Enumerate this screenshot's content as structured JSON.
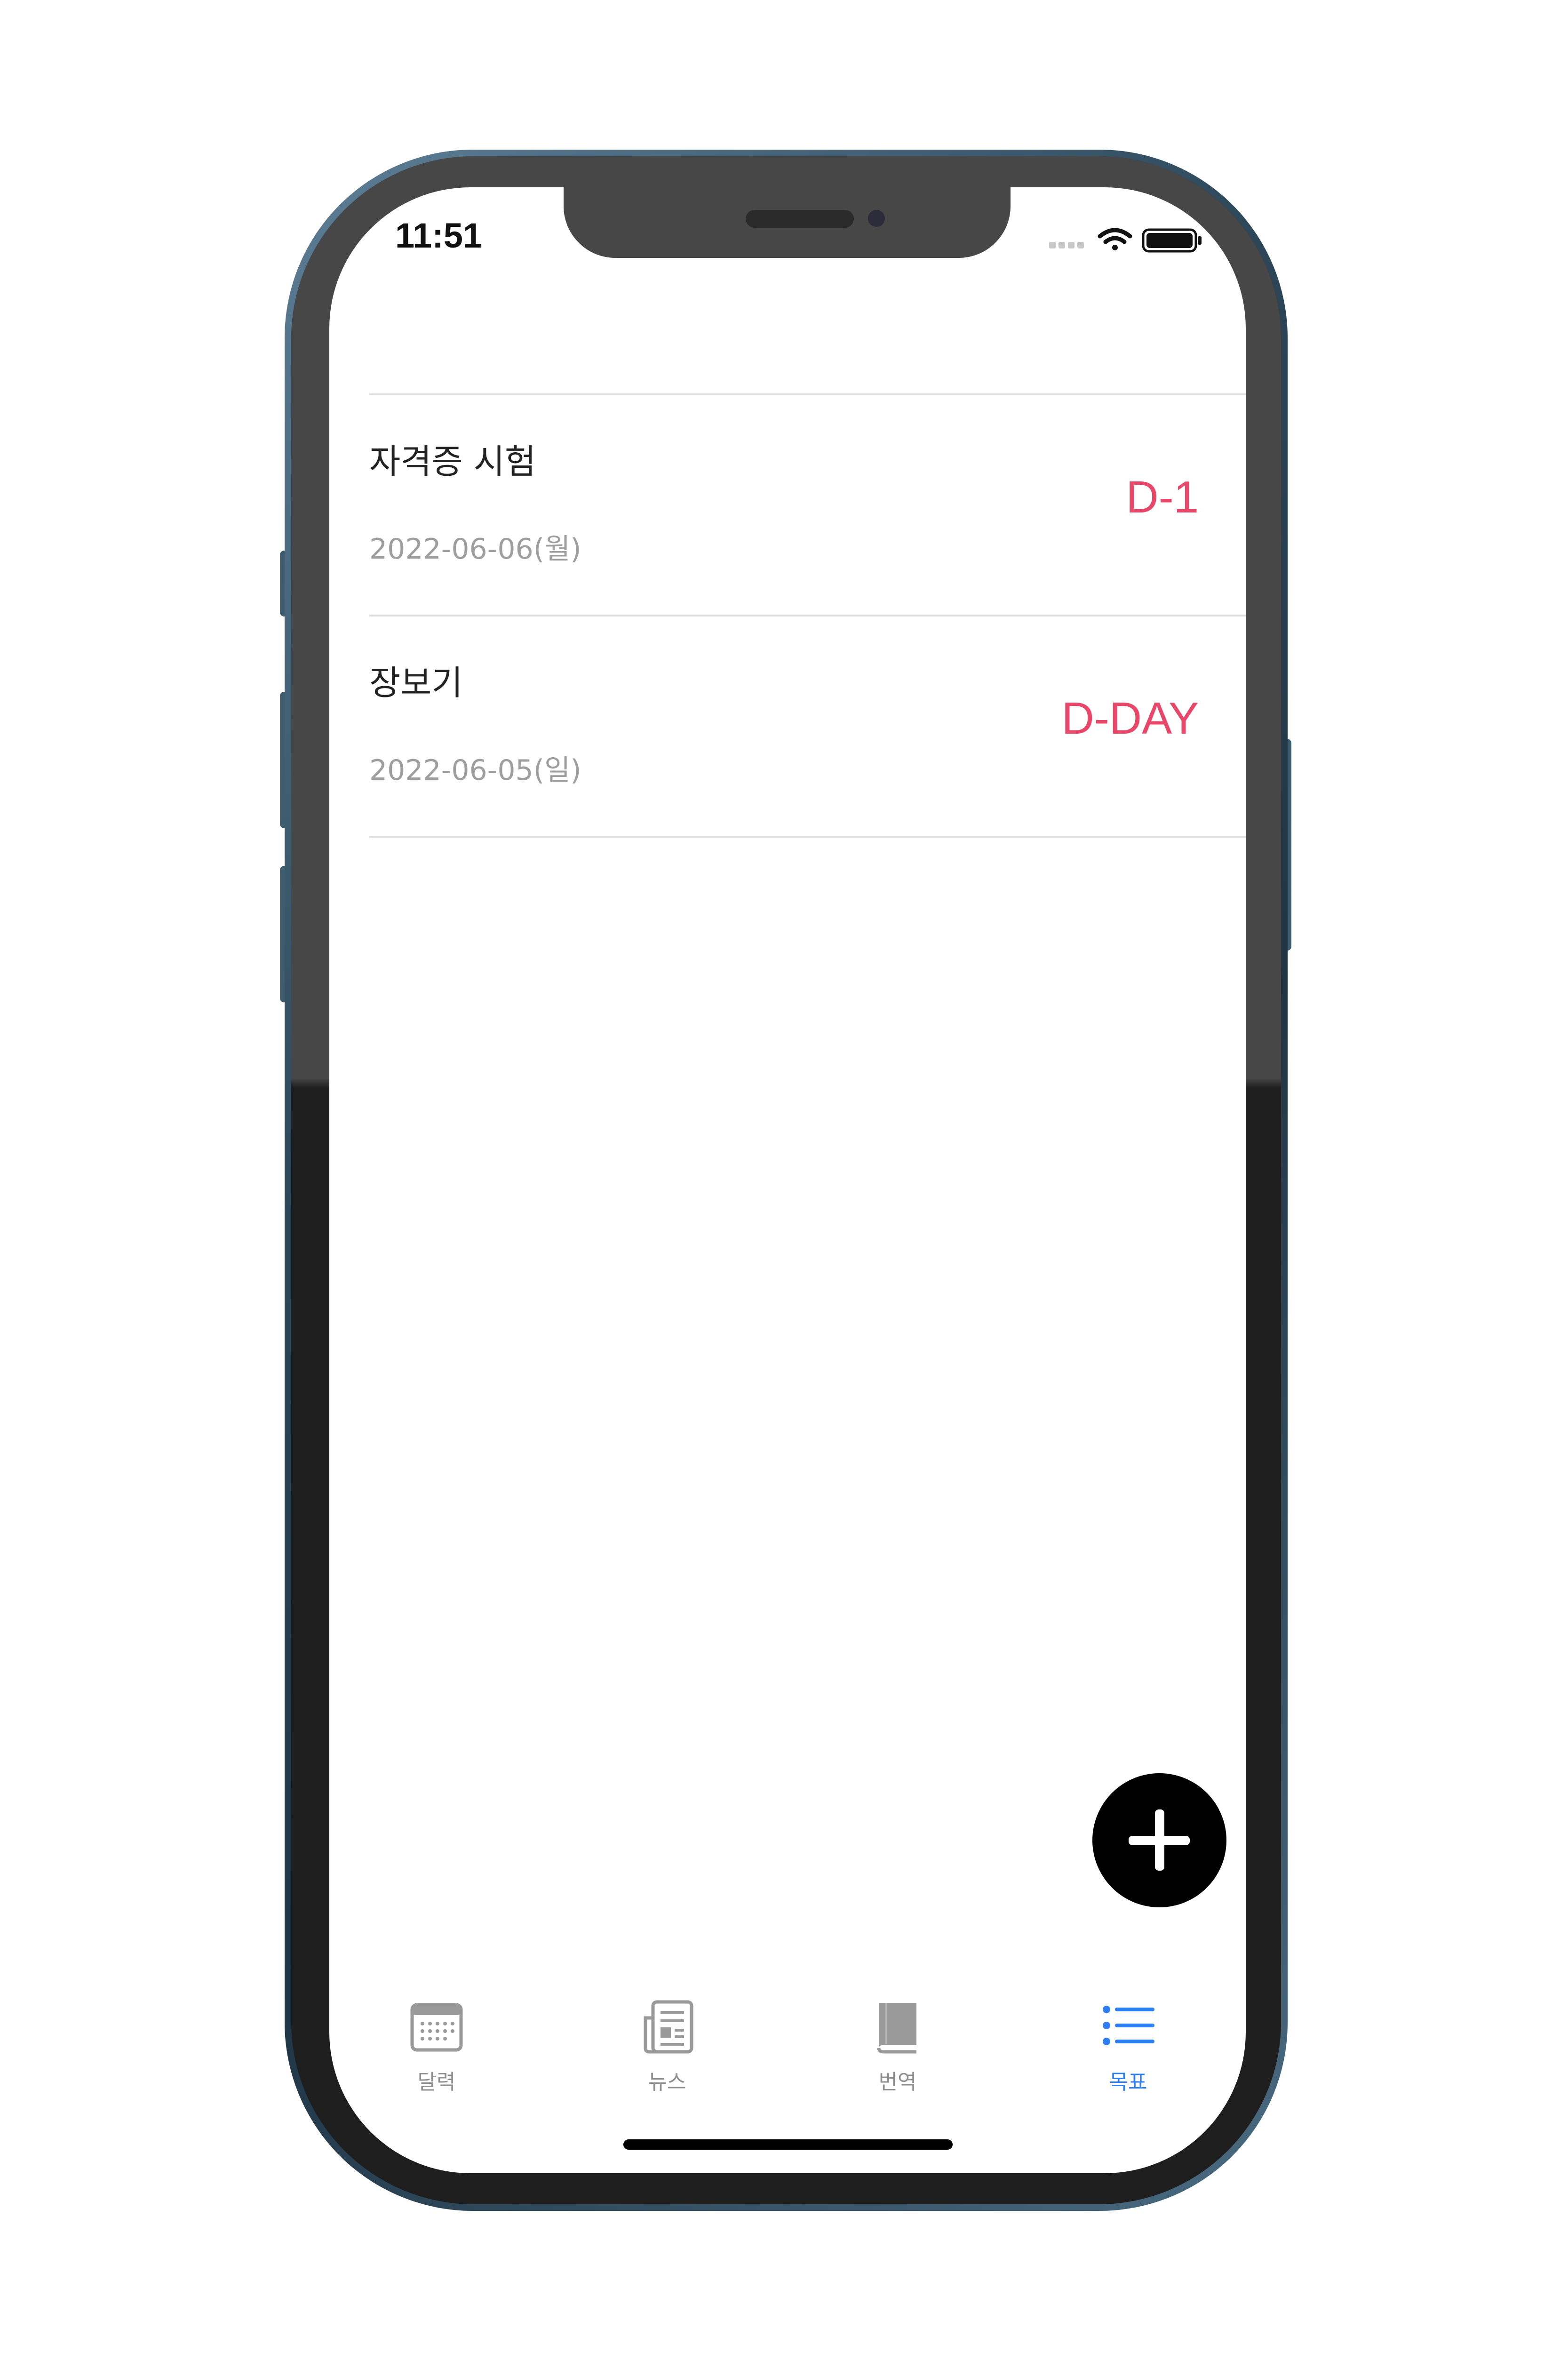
{
  "status_bar": {
    "time": "11:51"
  },
  "goals": [
    {
      "title": "자격증 시험",
      "date": "2022-06-06(월)",
      "dday": "D-1"
    },
    {
      "title": "장보기",
      "date": "2022-06-05(일)",
      "dday": "D-DAY"
    }
  ],
  "tabs": [
    {
      "label": "달력",
      "icon": "calendar-icon",
      "active": false
    },
    {
      "label": "뉴스",
      "icon": "newspaper-icon",
      "active": false
    },
    {
      "label": "번역",
      "icon": "book-icon",
      "active": false
    },
    {
      "label": "목표",
      "icon": "list-icon",
      "active": true
    }
  ],
  "colors": {
    "dday": "#e8476a",
    "tab_active": "#2f7ef0",
    "tab_inactive": "#8e8e8e",
    "fab": "#000000"
  }
}
